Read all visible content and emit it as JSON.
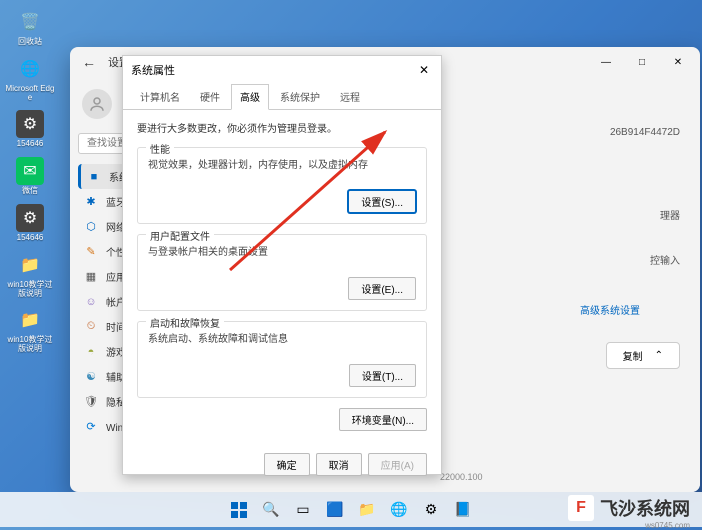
{
  "desktop": {
    "icons": [
      {
        "name": "recycle-bin",
        "label": "回收站"
      },
      {
        "name": "edge",
        "label": "Microsoft Edge"
      },
      {
        "name": "settings-shortcut",
        "label": "154646"
      },
      {
        "name": "wechat",
        "label": "微信"
      },
      {
        "name": "shortcut-2",
        "label": "154646"
      },
      {
        "name": "folder-1",
        "label": "win10教学过版说明"
      },
      {
        "name": "folder-2",
        "label": "win10教学过版说明"
      }
    ]
  },
  "settings": {
    "back": "←",
    "title": "设置",
    "window_min": "—",
    "window_max": "□",
    "window_close": "✕",
    "search_placeholder": "查找设置",
    "nav": [
      {
        "icon": "■",
        "label": "系统",
        "active": true
      },
      {
        "icon": "✱",
        "label": "蓝牙"
      },
      {
        "icon": "⬡",
        "label": "网络"
      },
      {
        "icon": "✎",
        "label": "个性"
      },
      {
        "icon": "▦",
        "label": "应用"
      },
      {
        "icon": "☺",
        "label": "帐户"
      },
      {
        "icon": "⏲",
        "label": "时间"
      },
      {
        "icon": "◓",
        "label": "游戏"
      },
      {
        "icon": "☯",
        "label": "辅助"
      },
      {
        "icon": "🛡",
        "label": "隐私"
      },
      {
        "icon": "⟳",
        "label": "Windows 更新"
      }
    ],
    "info_id": "26B914F4472D",
    "info_proc": "理器",
    "info_pen": "控输入",
    "adv_link": "高级系统设置",
    "copy_label": "复制",
    "copy_chevron": "⌃",
    "build": "22000.100"
  },
  "sysprop": {
    "title": "系统属性",
    "close": "✕",
    "tabs": [
      "计算机名",
      "硬件",
      "高级",
      "系统保护",
      "远程"
    ],
    "active_tab": 2,
    "admin_note": "要进行大多数更改，你必须作为管理员登录。",
    "groups": [
      {
        "title": "性能",
        "desc": "视觉效果，处理器计划，内存使用，以及虚拟内存",
        "btn": "设置(S)..."
      },
      {
        "title": "用户配置文件",
        "desc": "与登录帐户相关的桌面设置",
        "btn": "设置(E)..."
      },
      {
        "title": "启动和故障恢复",
        "desc": "系统启动、系统故障和调试信息",
        "btn": "设置(T)..."
      }
    ],
    "env_btn": "环境变量(N)...",
    "ok": "确定",
    "cancel": "取消",
    "apply": "应用(A)"
  },
  "watermark": {
    "brand": "飞沙系统网",
    "url": "ws0745.com",
    "logo": "F"
  }
}
